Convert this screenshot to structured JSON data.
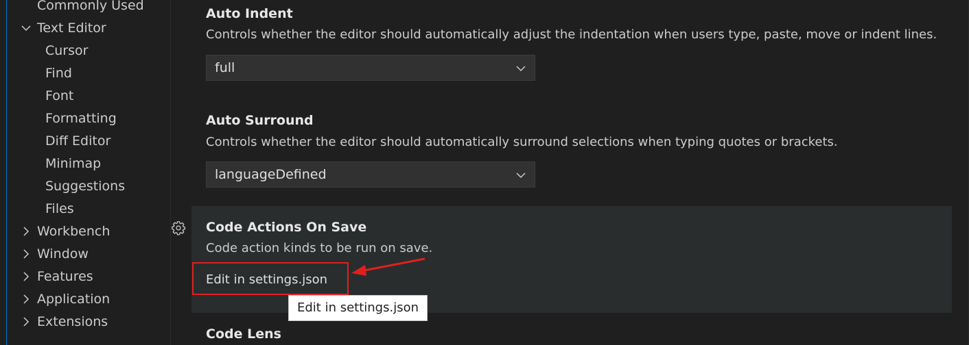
{
  "sidebar": {
    "items": [
      {
        "label": "Commonly Used"
      },
      {
        "label": "Text Editor",
        "expanded": true
      },
      {
        "label": "Cursor"
      },
      {
        "label": "Find"
      },
      {
        "label": "Font"
      },
      {
        "label": "Formatting"
      },
      {
        "label": "Diff Editor"
      },
      {
        "label": "Minimap"
      },
      {
        "label": "Suggestions"
      },
      {
        "label": "Files"
      },
      {
        "label": "Workbench",
        "expanded": false
      },
      {
        "label": "Window",
        "expanded": false
      },
      {
        "label": "Features",
        "expanded": false
      },
      {
        "label": "Application",
        "expanded": false
      },
      {
        "label": "Extensions",
        "expanded": false
      }
    ]
  },
  "settings": {
    "auto_indent": {
      "title": "Auto Indent",
      "description": "Controls whether the editor should automatically adjust the indentation when users type, paste, move or indent lines.",
      "value": "full"
    },
    "auto_surround": {
      "title": "Auto Surround",
      "description": "Controls whether the editor should automatically surround selections when typing quotes or brackets.",
      "value": "languageDefined"
    },
    "code_actions_on_save": {
      "title": "Code Actions On Save",
      "description": "Code action kinds to be run on save.",
      "edit_link": "Edit in settings.json",
      "tooltip": "Edit in settings.json"
    },
    "code_lens": {
      "title": "Code Lens"
    }
  },
  "icons": {
    "gear": "gear-icon",
    "chevron_right": "chevron-right-icon",
    "chevron_down": "chevron-down-icon"
  },
  "colors": {
    "background": "#1f1f1f",
    "focused_row": "#2a2d2e",
    "select_bg": "#313131",
    "annotation": "#e02020",
    "tree_guide": "#0078d4"
  }
}
